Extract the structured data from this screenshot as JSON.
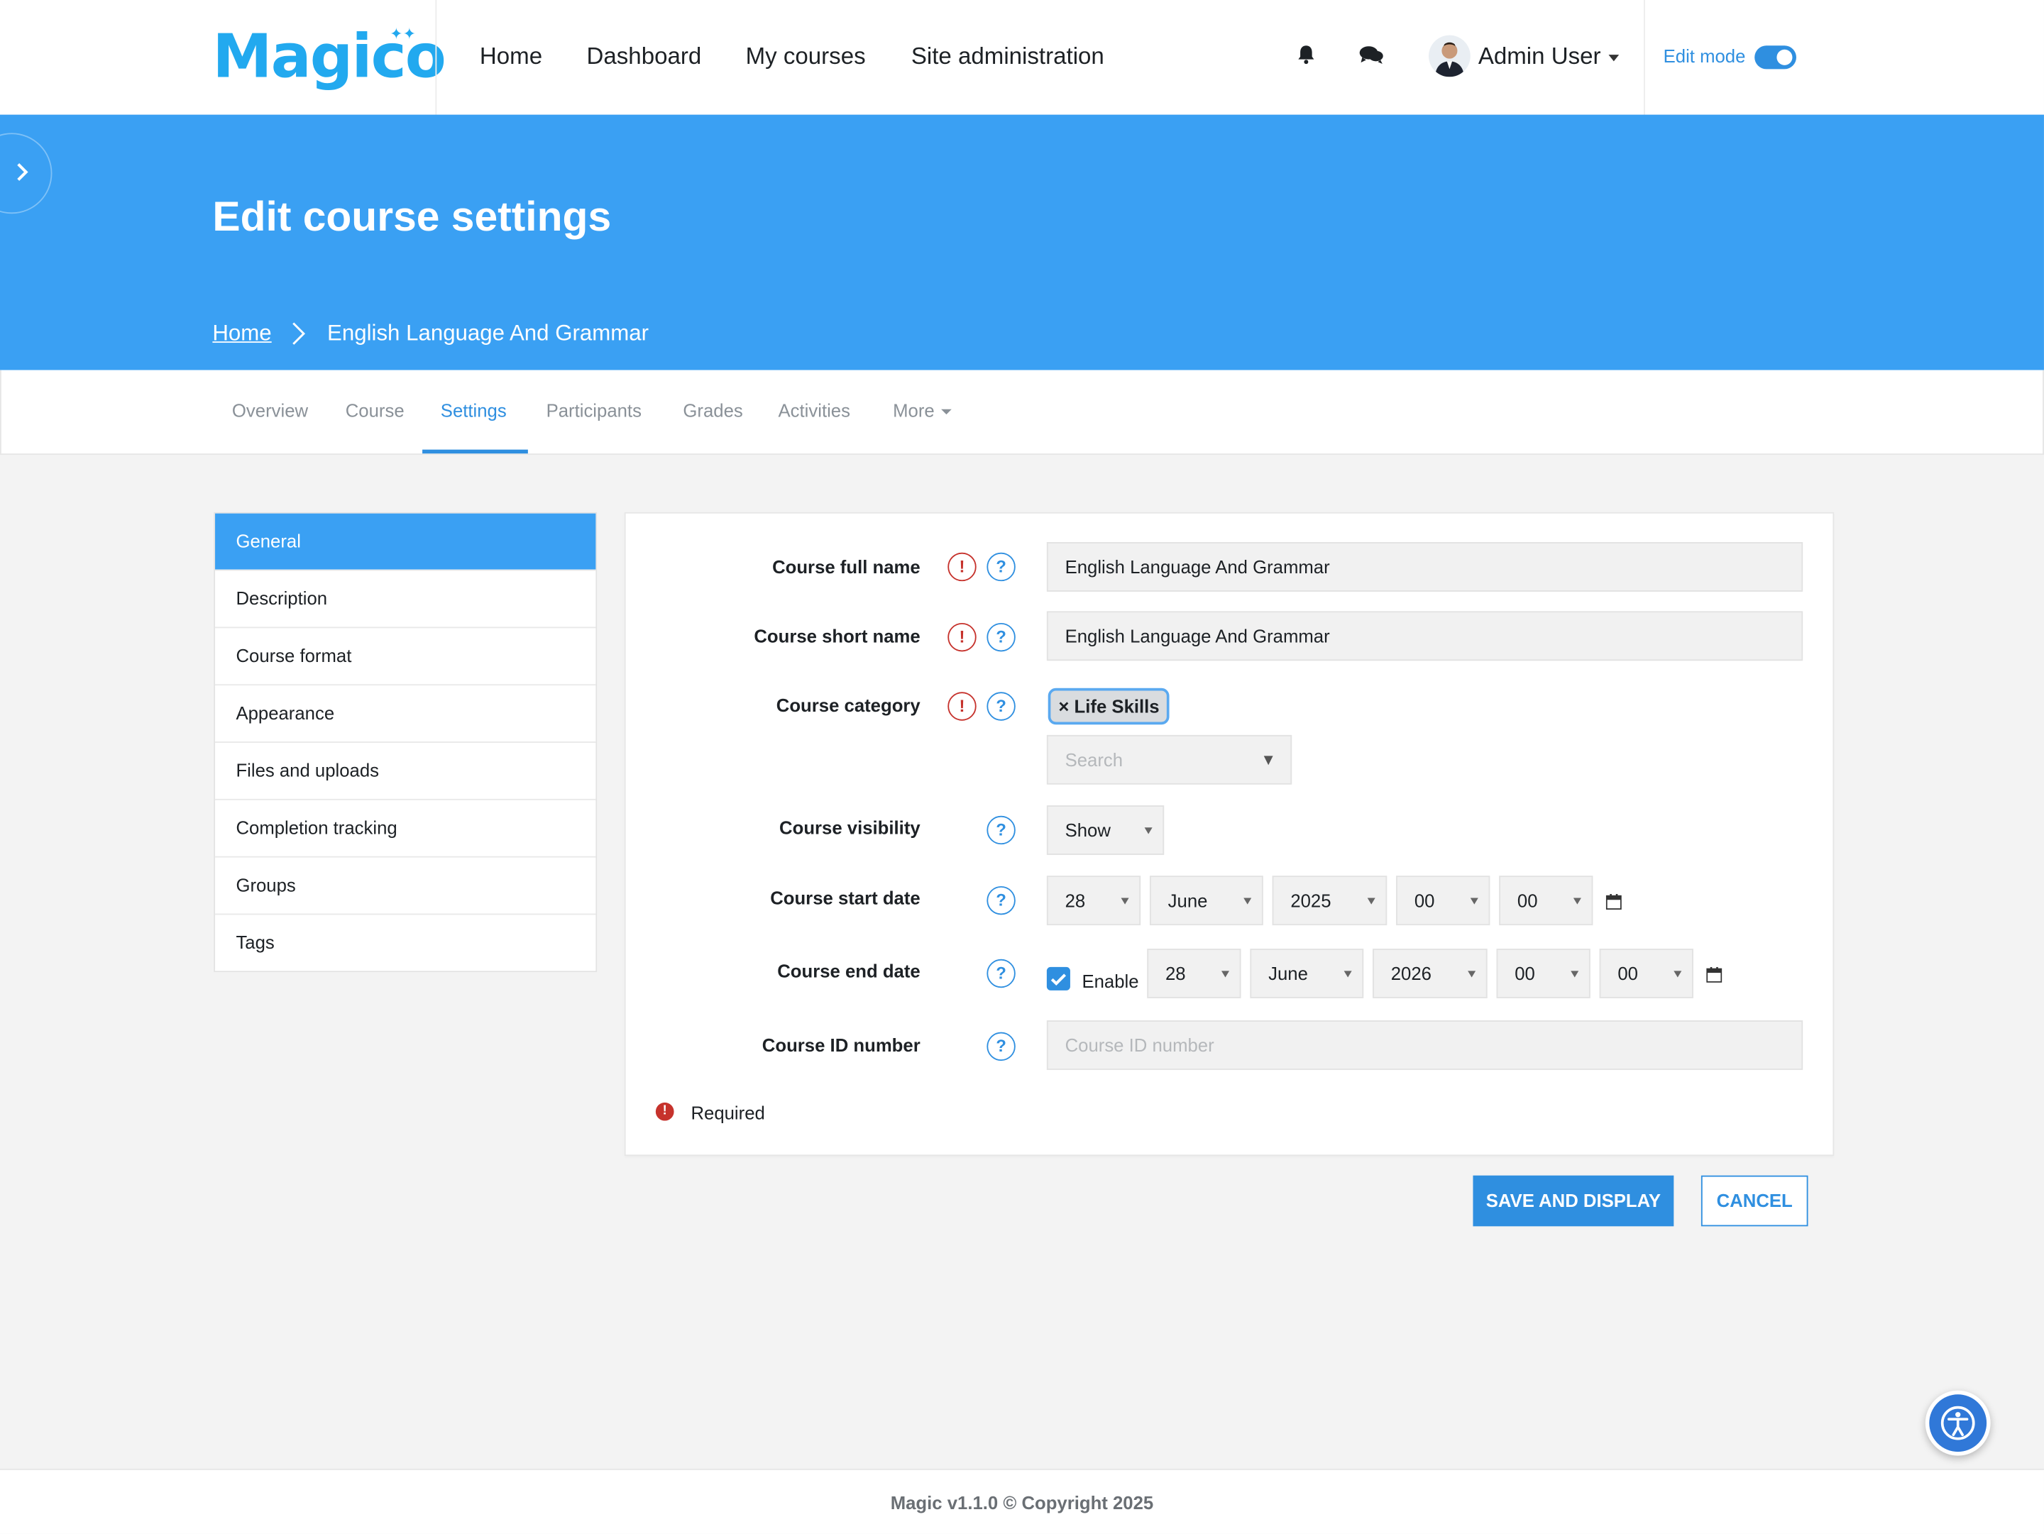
{
  "navbar": {
    "logo_text": "Magico",
    "links": [
      "Home",
      "Dashboard",
      "My courses",
      "Site administration"
    ],
    "user_name": "Admin User",
    "edit_mode_label": "Edit mode",
    "edit_mode_on": true,
    "icons": [
      "bell-icon",
      "chat-icon",
      "avatar",
      "caret-down-icon"
    ]
  },
  "header": {
    "title": "Edit course settings",
    "breadcrumb": {
      "home": "Home",
      "current": "English Language And Grammar"
    }
  },
  "tabs": {
    "items": [
      "Overview",
      "Course",
      "Settings",
      "Participants",
      "Grades",
      "Activities",
      "More"
    ],
    "active": "Settings"
  },
  "side_menu": {
    "items": [
      "General",
      "Description",
      "Course format",
      "Appearance",
      "Files and uploads",
      "Completion tracking",
      "Groups",
      "Tags"
    ],
    "active": "General"
  },
  "form": {
    "full_name": {
      "label": "Course full name",
      "value": "English Language And Grammar"
    },
    "short_name": {
      "label": "Course short name",
      "value": "English Language And Grammar"
    },
    "category": {
      "label": "Course category",
      "chip": "× Life Skills",
      "search_placeholder": "Search"
    },
    "visibility": {
      "label": "Course visibility",
      "value": "Show"
    },
    "start_date": {
      "label": "Course start date",
      "day": "28",
      "month": "June",
      "year": "2025",
      "hour": "00",
      "minute": "00"
    },
    "end_date": {
      "label": "Course end date",
      "enable_label": "Enable",
      "enabled": true,
      "day": "28",
      "month": "June",
      "year": "2026",
      "hour": "00",
      "minute": "00"
    },
    "id_number": {
      "label": "Course ID number",
      "placeholder": "Course ID number"
    },
    "required_note": "Required"
  },
  "buttons": {
    "save": "SAVE AND DISPLAY",
    "cancel": "CANCEL"
  },
  "footer": {
    "text": "Magic v1.1.0 © Copyright 2025"
  },
  "colors": {
    "primary": "#3aa0f3",
    "accent": "#2f8fe0",
    "required": "#c6322c",
    "background": "#f3f3f3"
  }
}
